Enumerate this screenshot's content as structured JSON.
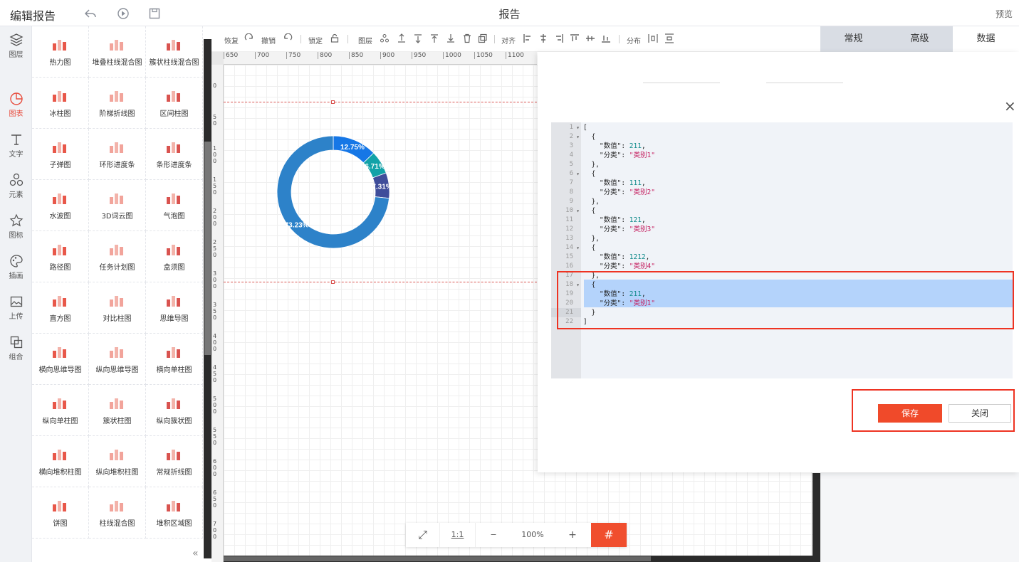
{
  "header": {
    "title": "编辑报告",
    "center_title": "报告",
    "preview": "预览"
  },
  "leftnav": [
    {
      "label": "图层",
      "icon": "layers-icon"
    },
    {
      "label": "图表",
      "icon": "chart-icon",
      "active": true
    },
    {
      "label": "文字",
      "icon": "text-icon"
    },
    {
      "label": "元素",
      "icon": "shapes-icon"
    },
    {
      "label": "图标",
      "icon": "star-icon"
    },
    {
      "label": "插画",
      "icon": "palette-icon"
    },
    {
      "label": "上传",
      "icon": "upload-image-icon"
    },
    {
      "label": "组合",
      "icon": "group-icon"
    }
  ],
  "palette": [
    "热力图",
    "堆叠柱线混合图",
    "簇状柱线混合图",
    "冰柱图",
    "阶梯折线图",
    "区间柱图",
    "子弹图",
    "环形进度条",
    "条形进度条",
    "水波图",
    "3D词云图",
    "气泡图",
    "路径图",
    "任务计划图",
    "盒须图",
    "直方图",
    "对比柱图",
    "思维导图",
    "横向思维导图",
    "纵向思维导图",
    "横向单柱图",
    "纵向单柱图",
    "簇状柱图",
    "纵向簇状图",
    "横向堆积柱图",
    "纵向堆积柱图",
    "常规折线图",
    "饼图",
    "柱线混合图",
    "堆积区域图"
  ],
  "toolbar": {
    "restore": "恢复",
    "undo": "撤销",
    "lock": "锁定",
    "layer": "图层",
    "align": "对齐",
    "distribute": "分布"
  },
  "ruler": {
    "h": [
      "650",
      "700",
      "750",
      "800",
      "850",
      "900",
      "950",
      "1000",
      "1050",
      "1100"
    ],
    "v": [
      "0",
      "50",
      "100",
      "150",
      "200",
      "250",
      "300",
      "350",
      "400",
      "450",
      "500",
      "550",
      "600",
      "650",
      "700"
    ]
  },
  "chart": {
    "slices": [
      {
        "label": "12.75%",
        "value": 12.75,
        "color": "#1677e6"
      },
      {
        "label": "6.71%",
        "value": 6.71,
        "color": "#12a2a8"
      },
      {
        "label": "7.31%",
        "value": 7.31,
        "color": "#3f4d9a"
      },
      {
        "label": "73.23%",
        "value": 73.23,
        "color": "#2d82c9"
      }
    ]
  },
  "zoom": {
    "fit": "⤢",
    "one_to_one": "1:1",
    "minus": "−",
    "level": "100%",
    "plus": "+",
    "grid": "#"
  },
  "rpanel": {
    "tabs": [
      "常规",
      "高级",
      "数据"
    ],
    "active": "数据",
    "ghost_save": "保存",
    "ghost_close": "关闭"
  },
  "dialog": {
    "close": "×",
    "lines": [
      "[",
      "  {",
      "    \"数值\": 211,",
      "    \"分类\": \"类别1\"",
      "  },",
      "  {",
      "    \"数值\": 111,",
      "    \"分类\": \"类别2\"",
      "  },",
      "  {",
      "    \"数值\": 121,",
      "    \"分类\": \"类别3\"",
      "  },",
      "  {",
      "    \"数值\": 1212,",
      "    \"分类\": \"类别4\"",
      "  },",
      "  {",
      "    \"数值\": 211,",
      "    \"分类\": \"类别1\"",
      "  }",
      "]"
    ],
    "save": "保存",
    "close_btn": "关闭"
  }
}
